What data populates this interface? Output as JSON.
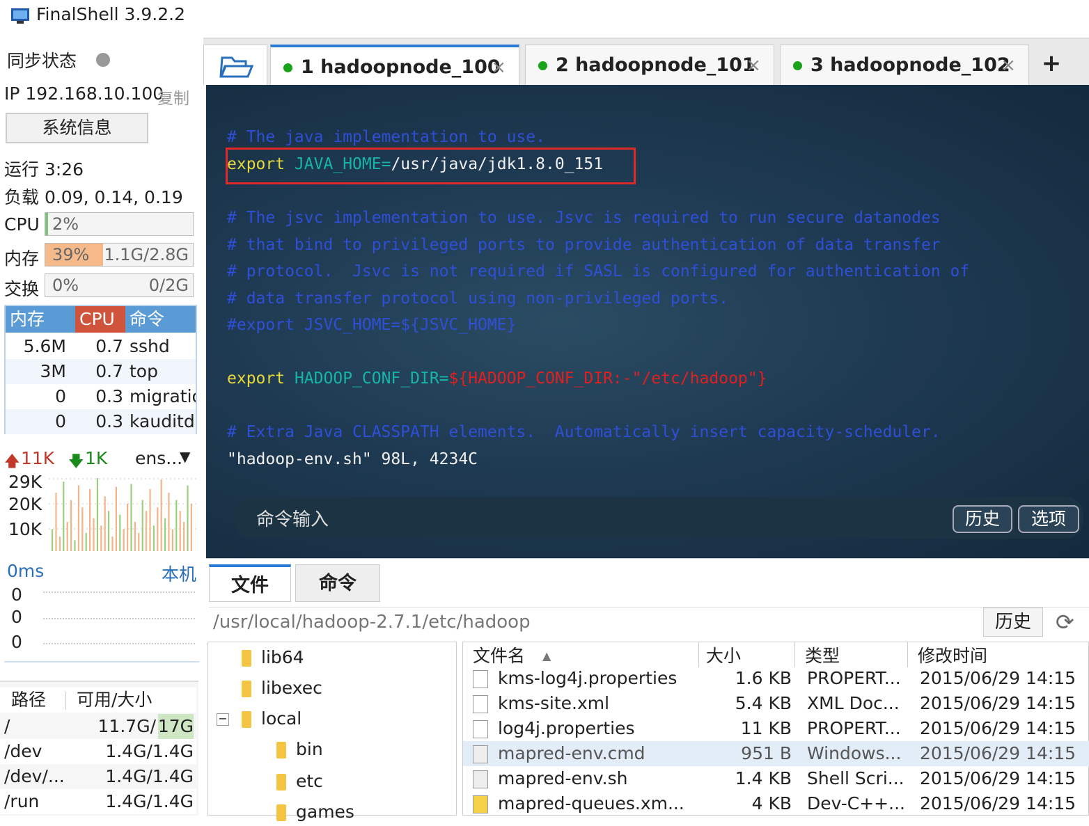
{
  "app": {
    "title": "FinalShell 3.9.2.2"
  },
  "left": {
    "sync_label": "同步状态",
    "ip_label": "IP 192.168.10.100",
    "copy_label": "复制",
    "sysinfo_button": "系统信息",
    "uptime": "运行 3:26",
    "load": "负载 0.09, 0.14, 0.19",
    "cpu_label": "CPU",
    "cpu_value": "2%",
    "cpu_percent": 2,
    "mem_label": "内存",
    "mem_percent_text": "39%",
    "mem_percent": 39,
    "mem_value": "1.1G/2.8G",
    "swap_label": "交换",
    "swap_percent_text": "0%",
    "swap_value": "0/2G",
    "proc_headers": [
      "内存",
      "CPU",
      "命令"
    ],
    "processes": [
      {
        "mem": "5.6M",
        "cpu": "0.7",
        "cmd": "sshd"
      },
      {
        "mem": "3M",
        "cpu": "0.7",
        "cmd": "top"
      },
      {
        "mem": "0",
        "cpu": "0.3",
        "cmd": "migratio"
      },
      {
        "mem": "0",
        "cpu": "0.3",
        "cmd": "kauditd"
      }
    ],
    "net_up": "11K",
    "net_down": "1K",
    "net_iface": "ens...",
    "net_scale": [
      "29K",
      "20K",
      "10K"
    ],
    "ping_ms": "0ms",
    "ping_host": "本机",
    "ping_values": [
      "0",
      "0",
      "0"
    ],
    "disk_headers": [
      "路径",
      "可用/大小"
    ],
    "disks": [
      {
        "path": "/",
        "size": "11.7G/",
        "total": "17G"
      },
      {
        "path": "/dev",
        "size": "1.4G/1.4G",
        "total": ""
      },
      {
        "path": "/dev/...",
        "size": "1.4G/1.4G",
        "total": ""
      },
      {
        "path": "/run",
        "size": "1.4G/1.4G",
        "total": ""
      }
    ]
  },
  "tabs": [
    {
      "label": "1  hadoopnode_100"
    },
    {
      "label": "2  hadoopnode_101"
    },
    {
      "label": "3  hadoopnode_102"
    }
  ],
  "tab_close": "×",
  "tab_add": "+",
  "terminal": {
    "line1": "# The java implementation to use.",
    "line2_kw": "export",
    "line2_var": "JAVA_HOME=",
    "line2_val": "/usr/java/jdk1.8.0_151",
    "line3": "# The jsvc implementation to use. Jsvc is required to run secure datanodes",
    "line4": "# that bind to privileged ports to provide authentication of data transfer",
    "line5": "# protocol.  Jsvc is not required if SASL is configured for authentication of",
    "line6": "# data transfer protocol using non-privileged ports.",
    "line7": "#export JSVC_HOME=${JSVC_HOME}",
    "line8_kw": "export",
    "line8_var": "HADOOP_CONF_DIR=",
    "line8_rest": "${HADOOP_CONF_DIR:-\"/etc/hadoop\"}",
    "line9": "# Extra Java CLASSPATH elements.  Automatically insert capacity-scheduler.",
    "status": "\"hadoop-env.sh\" 98L, 4234C",
    "cmd_placeholder": "命令输入",
    "history_btn": "历史",
    "options_btn": "选项"
  },
  "bottom": {
    "tab_files": "文件",
    "tab_cmds": "命令",
    "path": "/usr/local/hadoop-2.7.1/etc/hadoop",
    "history_btn": "历史",
    "tree": [
      "lib64",
      "libexec",
      "local",
      "bin",
      "etc",
      "games"
    ],
    "file_headers": [
      "文件名",
      "大小",
      "类型",
      "修改时间"
    ],
    "files": [
      {
        "name": "kms-log4j.properties",
        "size": "1.6 KB",
        "type": "PROPERT...",
        "time": "2015/06/29 14:15"
      },
      {
        "name": "kms-site.xml",
        "size": "5.4 KB",
        "type": "XML Doc...",
        "time": "2015/06/29 14:15"
      },
      {
        "name": "log4j.properties",
        "size": "11 KB",
        "type": "PROPERT...",
        "time": "2015/06/29 14:15"
      },
      {
        "name": "mapred-env.cmd",
        "size": "951 B",
        "type": "Windows...",
        "time": "2015/06/29 14:15"
      },
      {
        "name": "mapred-env.sh",
        "size": "1.4 KB",
        "type": "Shell Scri...",
        "time": "2015/06/29 14:15"
      },
      {
        "name": "mapred-queues.xm...",
        "size": "4 KB",
        "type": "Dev-C++...",
        "time": "2015/06/29 14:15"
      }
    ]
  }
}
